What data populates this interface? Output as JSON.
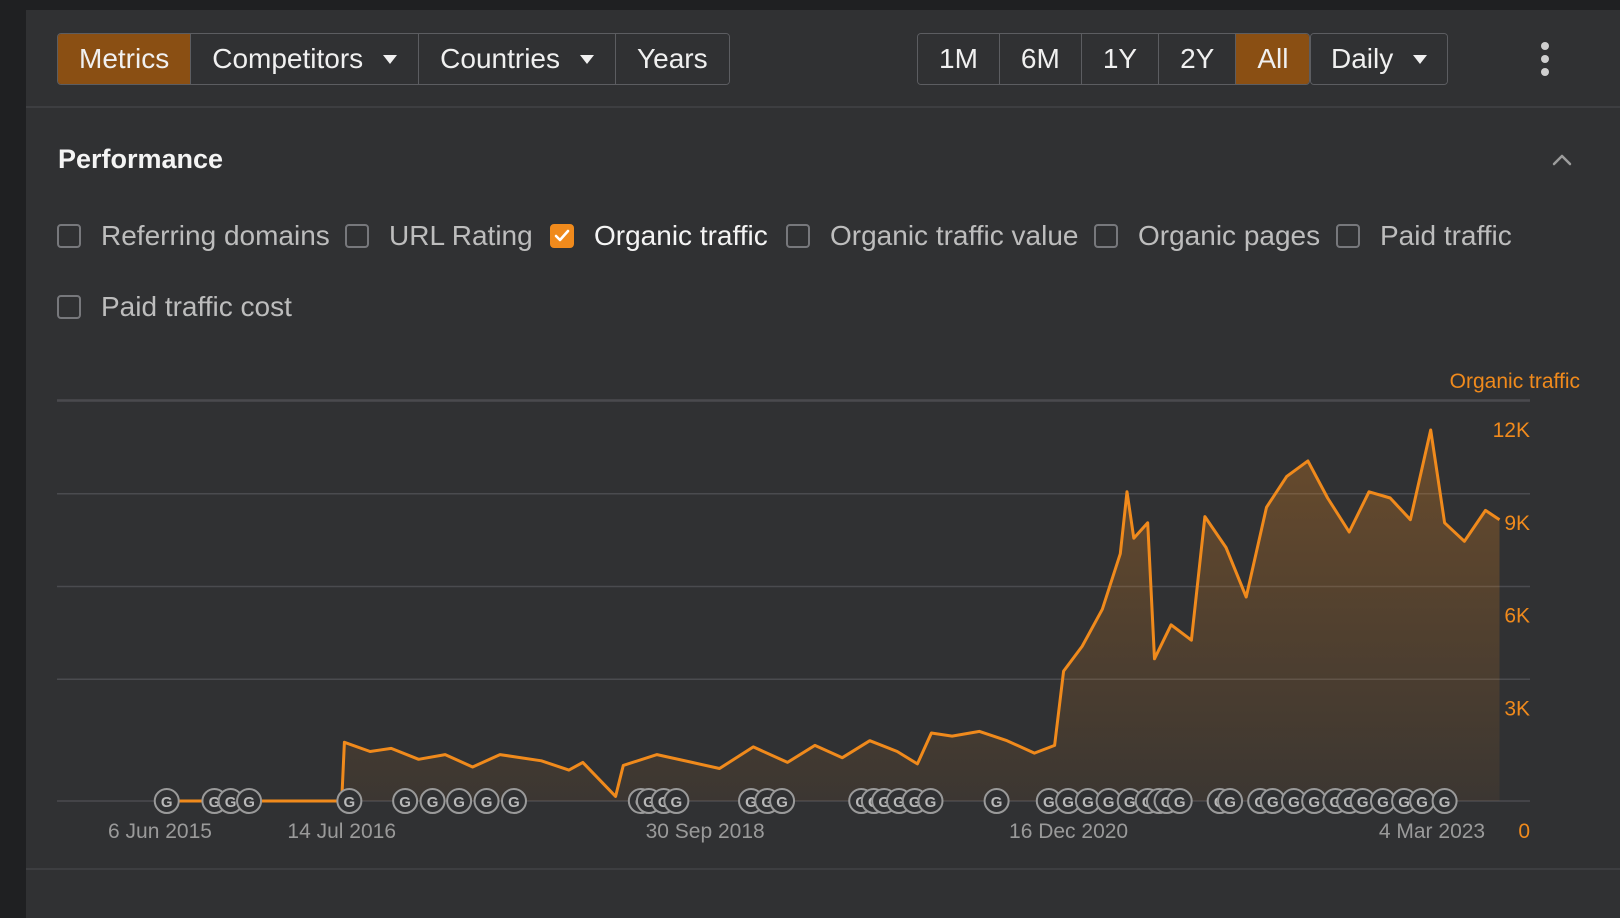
{
  "toolbar": {
    "left_tabs": [
      {
        "label": "Metrics",
        "active": true,
        "dropdown": false
      },
      {
        "label": "Competitors",
        "active": false,
        "dropdown": true
      },
      {
        "label": "Countries",
        "active": false,
        "dropdown": true
      },
      {
        "label": "Years",
        "active": false,
        "dropdown": false
      }
    ],
    "ranges": [
      {
        "label": "1M",
        "active": false
      },
      {
        "label": "6M",
        "active": false
      },
      {
        "label": "1Y",
        "active": false
      },
      {
        "label": "2Y",
        "active": false
      },
      {
        "label": "All",
        "active": true
      }
    ],
    "interval": "Daily",
    "more_icon": "kebab-vertical-icon"
  },
  "section": {
    "title": "Performance",
    "collapse_icon": "chevron-up-icon"
  },
  "metrics": [
    {
      "label": "Referring domains",
      "checked": false
    },
    {
      "label": "URL Rating",
      "checked": false
    },
    {
      "label": "Organic traffic",
      "checked": true
    },
    {
      "label": "Organic traffic value",
      "checked": false
    },
    {
      "label": "Organic pages",
      "checked": false
    },
    {
      "label": "Paid traffic",
      "checked": false
    },
    {
      "label": "Paid traffic cost",
      "checked": false
    }
  ],
  "colors": {
    "accent": "#f08a1c",
    "active_button": "#8a4f13",
    "panel": "#303133",
    "background": "#1f2022"
  },
  "chart_data": {
    "type": "area",
    "series": [
      {
        "name": "Organic traffic",
        "points": [
          [
            "2015-06-06",
            0
          ],
          [
            "2016-01-01",
            0
          ],
          [
            "2016-07-14",
            0
          ],
          [
            "2016-07-20",
            1900
          ],
          [
            "2016-09-15",
            1600
          ],
          [
            "2016-11-01",
            1700
          ],
          [
            "2017-01-01",
            1350
          ],
          [
            "2017-03-01",
            1500
          ],
          [
            "2017-05-01",
            1100
          ],
          [
            "2017-07-01",
            1500
          ],
          [
            "2017-10-01",
            1300
          ],
          [
            "2017-12-01",
            1000
          ],
          [
            "2018-01-01",
            1250
          ],
          [
            "2018-03-15",
            150
          ],
          [
            "2018-04-01",
            1150
          ],
          [
            "2018-06-15",
            1500
          ],
          [
            "2018-09-01",
            1250
          ],
          [
            "2018-11-01",
            1050
          ],
          [
            "2019-01-15",
            1750
          ],
          [
            "2019-04-01",
            1250
          ],
          [
            "2019-06-01",
            1800
          ],
          [
            "2019-08-01",
            1400
          ],
          [
            "2019-10-01",
            1950
          ],
          [
            "2019-12-01",
            1600
          ],
          [
            "2020-01-15",
            1200
          ],
          [
            "2020-02-15",
            2200
          ],
          [
            "2020-04-01",
            2100
          ],
          [
            "2020-06-01",
            2250
          ],
          [
            "2020-08-01",
            1950
          ],
          [
            "2020-10-01",
            1550
          ],
          [
            "2020-11-15",
            1800
          ],
          [
            "2020-12-05",
            4200
          ],
          [
            "2021-01-15",
            5000
          ],
          [
            "2021-03-01",
            6200
          ],
          [
            "2021-04-10",
            8000
          ],
          [
            "2021-04-25",
            10000
          ],
          [
            "2021-05-10",
            8500
          ],
          [
            "2021-06-10",
            9000
          ],
          [
            "2021-06-25",
            4600
          ],
          [
            "2021-08-01",
            5700
          ],
          [
            "2021-09-15",
            5200
          ],
          [
            "2021-10-15",
            9200
          ],
          [
            "2021-12-01",
            8200
          ],
          [
            "2022-01-15",
            6600
          ],
          [
            "2022-03-01",
            9500
          ],
          [
            "2022-04-15",
            10500
          ],
          [
            "2022-06-01",
            11000
          ],
          [
            "2022-07-15",
            9800
          ],
          [
            "2022-09-01",
            8700
          ],
          [
            "2022-10-15",
            10000
          ],
          [
            "2022-12-01",
            9800
          ],
          [
            "2023-01-15",
            9100
          ],
          [
            "2023-03-01",
            12000
          ],
          [
            "2023-04-01",
            9000
          ],
          [
            "2023-05-15",
            8400
          ],
          [
            "2023-07-01",
            9400
          ],
          [
            "2023-08-01",
            9100
          ]
        ]
      }
    ],
    "x_domain": [
      "2015-06-06",
      "2023-08-01"
    ],
    "x_ticks": [
      {
        "date": "2015-06-06",
        "label": "6 Jun 2015"
      },
      {
        "date": "2016-07-14",
        "label": "14 Jul 2016"
      },
      {
        "date": "2018-09-30",
        "label": "30 Sep 2018"
      },
      {
        "date": "2020-12-16",
        "label": "16 Dec 2020"
      },
      {
        "date": "2023-03-04",
        "label": "4 Mar 2023"
      }
    ],
    "y_ticks": [
      {
        "value": 0,
        "label": "0"
      },
      {
        "value": 3000,
        "label": "3K"
      },
      {
        "value": 6000,
        "label": "6K"
      },
      {
        "value": 9000,
        "label": "9K"
      },
      {
        "value": 12000,
        "label": "12K"
      }
    ],
    "ylim": [
      0,
      12000
    ],
    "y_axis_title": "Organic traffic",
    "axis_side": "right",
    "grid": true,
    "update_marker_label": "G",
    "update_markers": [
      "2015-06-21",
      "2015-10-05",
      "2015-11-10",
      "2015-12-21",
      "2016-07-31",
      "2016-12-02",
      "2017-02-01",
      "2017-04-01",
      "2017-06-01",
      "2017-08-01",
      "2018-05-10",
      "2018-05-28",
      "2018-06-30",
      "2018-07-28",
      "2019-01-10",
      "2019-02-15",
      "2019-03-20",
      "2019-09-12",
      "2019-10-10",
      "2019-11-02",
      "2019-12-05",
      "2020-01-09",
      "2020-02-13",
      "2020-07-09",
      "2020-11-02",
      "2020-12-15",
      "2021-01-28",
      "2021-03-15",
      "2021-05-01",
      "2021-06-10",
      "2021-07-05",
      "2021-07-22",
      "2021-08-20",
      "2021-11-17",
      "2021-12-10",
      "2022-02-15",
      "2022-03-15",
      "2022-05-01",
      "2022-06-15",
      "2022-08-01",
      "2022-09-01",
      "2022-10-01",
      "2022-11-15",
      "2023-01-01",
      "2023-02-10",
      "2023-04-01"
    ]
  }
}
